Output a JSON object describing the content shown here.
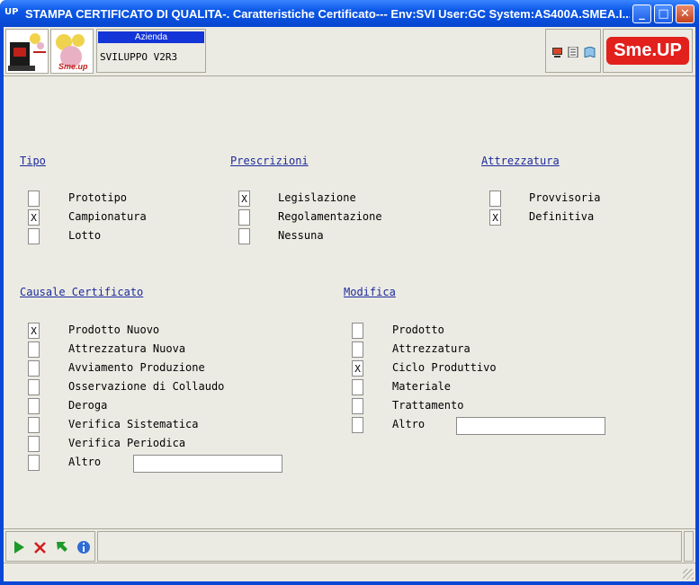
{
  "window": {
    "app_icon": "UP",
    "title": "STAMPA CERTIFICATO DI QUALITA-.  Caratteristiche  Certificato--- Env:SVI User:GC System:AS400A.SMEA.I...",
    "minimize": "_",
    "maximize": "□",
    "close": "✕"
  },
  "toolbar": {
    "logo2_text": "Sme.up",
    "azienda_label": "Azienda",
    "azienda_value": "SVILUPPO V2R3",
    "brand": "Sme.UP"
  },
  "tipo": {
    "title": "Tipo",
    "items": [
      {
        "label": "Prototipo",
        "mark": ""
      },
      {
        "label": "Campionatura",
        "mark": "X"
      },
      {
        "label": "Lotto",
        "mark": ""
      }
    ]
  },
  "prescrizioni": {
    "title": "Prescrizioni",
    "items": [
      {
        "label": "Legislazione",
        "mark": "X"
      },
      {
        "label": "Regolamentazione",
        "mark": ""
      },
      {
        "label": "Nessuna",
        "mark": ""
      }
    ]
  },
  "attrezzatura": {
    "title": "Attrezzatura",
    "items": [
      {
        "label": "Provvisoria",
        "mark": ""
      },
      {
        "label": "Definitiva",
        "mark": "X"
      }
    ]
  },
  "causale": {
    "title": "Causale Certificato",
    "items": [
      {
        "label": "Prodotto Nuovo",
        "mark": "X"
      },
      {
        "label": "Attrezzatura Nuova",
        "mark": ""
      },
      {
        "label": "Avviamento Produzione",
        "mark": ""
      },
      {
        "label": "Osservazione di Collaudo",
        "mark": ""
      },
      {
        "label": "Deroga",
        "mark": ""
      },
      {
        "label": "Verifica Sistematica",
        "mark": ""
      },
      {
        "label": "Verifica Periodica",
        "mark": ""
      },
      {
        "label": "Altro",
        "mark": ""
      }
    ],
    "altro_value": ""
  },
  "modifica": {
    "title": "Modifica",
    "items": [
      {
        "label": "Prodotto",
        "mark": ""
      },
      {
        "label": "Attrezzatura",
        "mark": ""
      },
      {
        "label": "Ciclo Produttivo",
        "mark": "X"
      },
      {
        "label": "Materiale",
        "mark": ""
      },
      {
        "label": "Trattamento",
        "mark": ""
      },
      {
        "label": "Altro",
        "mark": ""
      }
    ],
    "altro_value": ""
  },
  "bottom_icons": [
    "confirm-play-icon",
    "cancel-x-icon",
    "back-arrow-icon",
    "info-icon"
  ],
  "colors": {
    "title_blue": "#0b57e6",
    "section_title": "#1c2a9c",
    "azienda_label_bg": "#1334d6",
    "brand_red": "#e2201c"
  }
}
